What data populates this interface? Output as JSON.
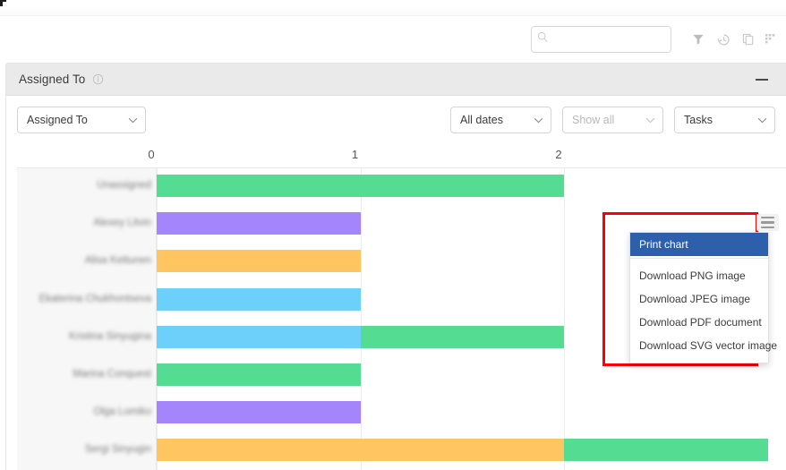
{
  "toolbar": {
    "search": {
      "value": "",
      "placeholder": ""
    },
    "icons": [
      {
        "name": "filter-icon",
        "label": "Filter"
      },
      {
        "name": "history-icon",
        "label": "History"
      },
      {
        "name": "copy-icon",
        "label": "Copy"
      },
      {
        "name": "grid-icon",
        "label": "Grid"
      }
    ]
  },
  "panel": {
    "title": "Assigned To",
    "info_icon": "info-icon",
    "minimize_label": "—"
  },
  "filters": {
    "assigned_to": {
      "label": "Assigned To",
      "muted": false
    },
    "dates": {
      "label": "All dates",
      "muted": false
    },
    "show": {
      "label": "Show all",
      "muted": true
    },
    "type": {
      "label": "Tasks",
      "muted": false
    }
  },
  "export_menu": {
    "hamburger": "hamburger-icon",
    "items": [
      {
        "label": "Print chart",
        "active": true
      },
      {
        "label": "Download PNG image",
        "active": false
      },
      {
        "label": "Download JPEG image",
        "active": false
      },
      {
        "label": "Download PDF document",
        "active": false
      },
      {
        "label": "Download SVG vector image",
        "active": false
      }
    ]
  },
  "colors": {
    "green": "#54dd92",
    "purple": "#a585fb",
    "orange": "#ffc561",
    "blue": "#6dd0fb",
    "menu_active": "#2e5fab",
    "highlight_border": "#ff0000",
    "panel_header": "#eaeaea",
    "label_col": "#f7f7f7"
  },
  "chart_data": {
    "type": "bar",
    "orientation": "horizontal",
    "stacked": true,
    "title": "Assigned To",
    "xlabel": "",
    "ylabel": "",
    "xlim": [
      0,
      3.1
    ],
    "xticks": [
      0,
      1,
      2
    ],
    "xtick_labels": [
      "0",
      "1",
      "2"
    ],
    "grid": true,
    "legend": "none",
    "categories": [
      "Unassigned",
      "Alexey Litvin",
      "Alisa Kettunen",
      "Ekaterina Chukhontseva",
      "Kristina Sinyugina",
      "Marina Conquest",
      "Olga Lomiko",
      "Sergi Sinyugin"
    ],
    "rows": [
      {
        "category": "Unassigned",
        "segments": [
          {
            "color": "#54dd92",
            "value": 2
          }
        ]
      },
      {
        "category": "Alexey Litvin",
        "segments": [
          {
            "color": "#a585fb",
            "value": 1
          }
        ]
      },
      {
        "category": "Alisa Kettunen",
        "segments": [
          {
            "color": "#ffc561",
            "value": 1
          }
        ]
      },
      {
        "category": "Ekaterina Chukhontseva",
        "segments": [
          {
            "color": "#6dd0fb",
            "value": 1
          }
        ]
      },
      {
        "category": "Kristina Sinyugina",
        "segments": [
          {
            "color": "#6dd0fb",
            "value": 1
          },
          {
            "color": "#54dd92",
            "value": 1
          }
        ]
      },
      {
        "category": "Marina Conquest",
        "segments": [
          {
            "color": "#54dd92",
            "value": 1
          }
        ]
      },
      {
        "category": "Olga Lomiko",
        "segments": [
          {
            "color": "#a585fb",
            "value": 1
          }
        ]
      },
      {
        "category": "Sergi Sinyugin",
        "segments": [
          {
            "color": "#ffc561",
            "value": 2
          },
          {
            "color": "#54dd92",
            "value": 1
          }
        ]
      }
    ]
  }
}
